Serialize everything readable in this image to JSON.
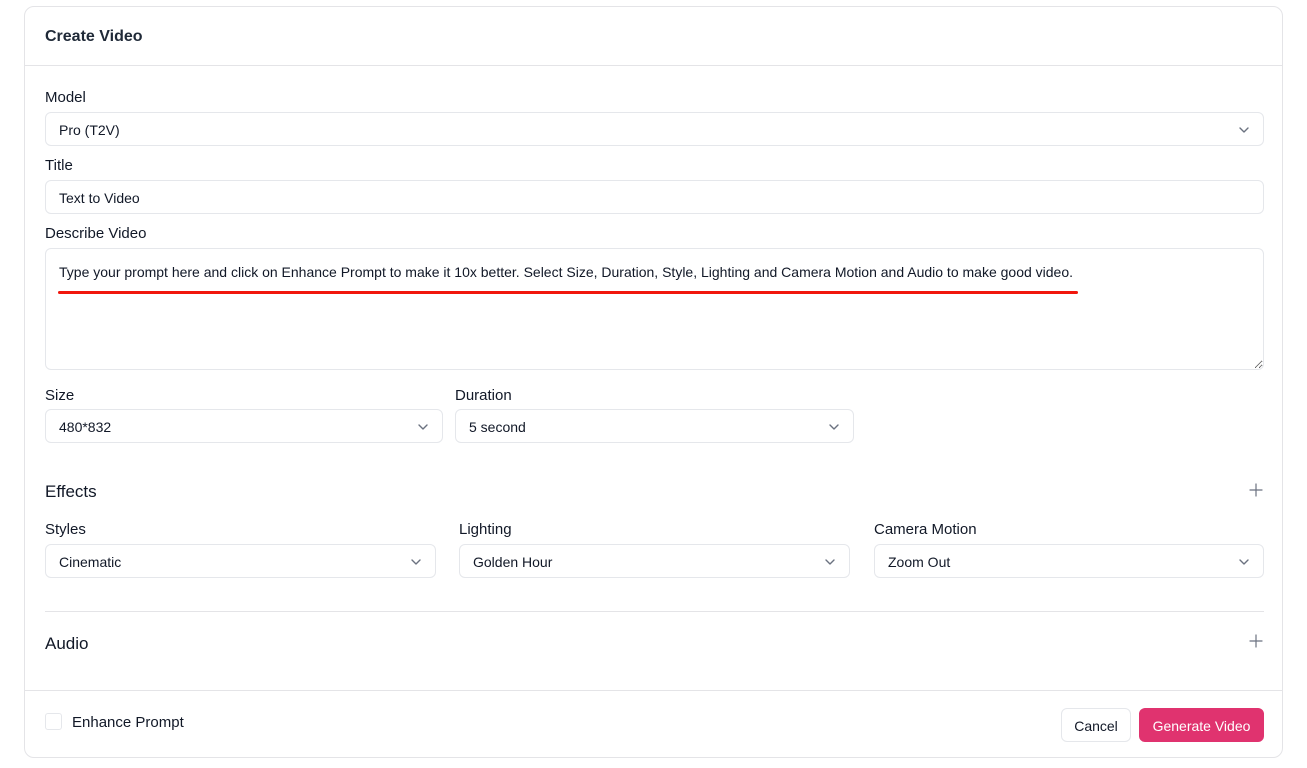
{
  "dialog": {
    "title": "Create Video"
  },
  "form": {
    "model": {
      "label": "Model",
      "value": "Pro (T2V)"
    },
    "title": {
      "label": "Title",
      "value": "Text to Video"
    },
    "describe": {
      "label": "Describe Video",
      "value": "Type your prompt here and click on Enhance Prompt to make it 10x better. Select Size, Duration, Style, Lighting and Camera Motion and Audio to make good video."
    },
    "size": {
      "label": "Size",
      "value": "480*832"
    },
    "duration": {
      "label": "Duration",
      "value": "5 second"
    }
  },
  "effects": {
    "title": "Effects",
    "styles": {
      "label": "Styles",
      "value": "Cinematic"
    },
    "lighting": {
      "label": "Lighting",
      "value": "Golden Hour"
    },
    "camera_motion": {
      "label": "Camera Motion",
      "value": "Zoom Out"
    }
  },
  "audio": {
    "title": "Audio"
  },
  "footer": {
    "enhance_prompt_label": "Enhance Prompt",
    "cancel_label": "Cancel",
    "generate_label": "Generate Video"
  },
  "colors": {
    "accent": "#e0336f",
    "annotation_underline": "#f1170d"
  },
  "icons": {
    "dropdown": "chevron-down-icon",
    "expand": "plus-icon"
  }
}
